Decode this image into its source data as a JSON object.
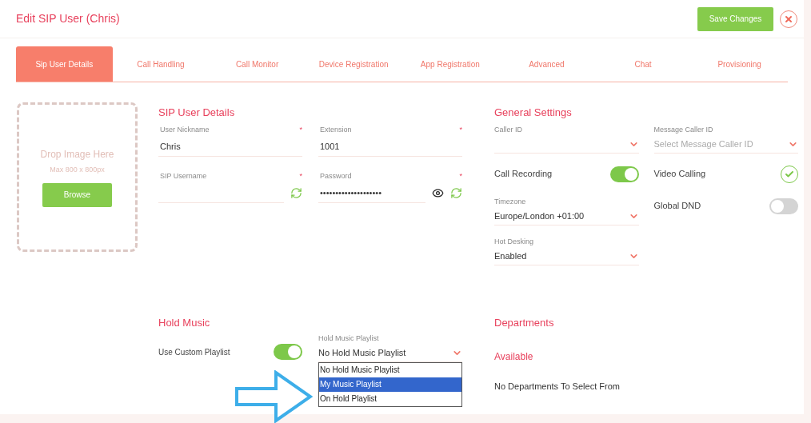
{
  "title": "Edit SIP User (Chris)",
  "save_button": "Save Changes",
  "tabs": [
    {
      "label": "Sip User Details",
      "selected": true
    },
    {
      "label": "Call Handling",
      "selected": false
    },
    {
      "label": "Call Monitor",
      "selected": false
    },
    {
      "label": "Device Registration",
      "selected": false
    },
    {
      "label": "App Registration",
      "selected": false
    },
    {
      "label": "Advanced",
      "selected": false
    },
    {
      "label": "Chat",
      "selected": false
    },
    {
      "label": "Provisioning",
      "selected": false
    }
  ],
  "dropzone": {
    "title": "Drop Image Here",
    "hint": "Max 800 x 800px",
    "button": "Browse"
  },
  "sip_user_details": {
    "heading": "SIP User Details",
    "fields": [
      {
        "kind": "text",
        "label": "User Nickname",
        "value": "Chris",
        "required_mark": "*"
      },
      {
        "kind": "text",
        "label": "Extension",
        "value": "1001",
        "required_mark": "*"
      },
      {
        "kind": "generated",
        "label": "SIP Username",
        "required_mark": "*"
      },
      {
        "kind": "password",
        "label": "Password",
        "value": "••••••••••••••••••••",
        "required_mark": "*"
      }
    ]
  },
  "general_settings": {
    "heading": "General Settings",
    "left": [
      {
        "kind": "select",
        "label": "Caller ID"
      },
      {
        "kind": "toggle",
        "label": "Call Recording",
        "on": true
      },
      {
        "kind": "select",
        "label": "Timezone",
        "value": "Europe/London +01:00"
      },
      {
        "kind": "select",
        "label": "Hot Desking",
        "value": "Enabled"
      }
    ],
    "right": [
      {
        "kind": "select",
        "label": "Message Caller ID",
        "placeholder": "Select Message Caller ID"
      },
      {
        "kind": "check",
        "label": "Video Calling",
        "checked": true
      },
      {
        "kind": "toggle",
        "label": "Global DND",
        "on": false
      }
    ]
  },
  "hold_music": {
    "heading": "Hold Music",
    "custom_playlist": {
      "label": "Use Custom Playlist",
      "on": true
    },
    "playlist": {
      "label": "Hold Music Playlist",
      "value": "No Hold Music Playlist",
      "options": [
        {
          "label": "No Hold Music Playlist",
          "highlighted": false
        },
        {
          "label": "My Music Playlist",
          "highlighted": true
        },
        {
          "label": "On Hold Playlist",
          "highlighted": false
        }
      ]
    }
  },
  "departments": {
    "heading": "Departments",
    "subheading": "Available",
    "empty_text": "No Departments To Select From"
  }
}
